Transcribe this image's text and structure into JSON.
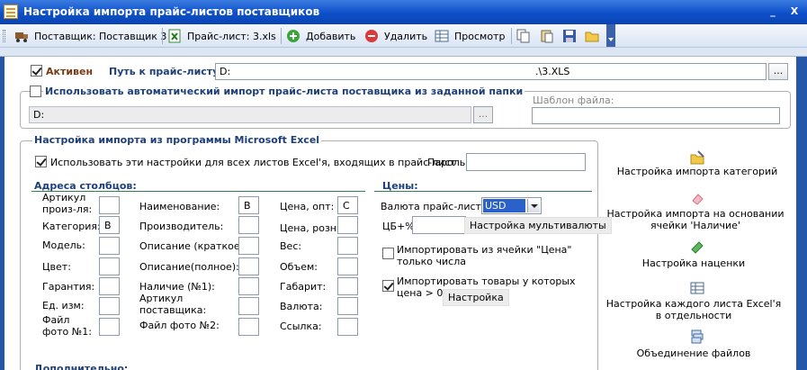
{
  "window": {
    "title": "Настройка импорта прайс-листов поставщиков",
    "minimize": "_",
    "close": "X"
  },
  "toolbar": {
    "supplier_label": "Поставщик: Поставщик 3",
    "pricelist_label": "Прайс-лист: 3.xls",
    "add_label": "Добавить",
    "delete_label": "Удалить",
    "view_label": "Просмотр"
  },
  "top": {
    "active_label": "Активен",
    "path_label": "Путь к прайс-листу:",
    "path_prefix": "D:",
    "path_suffix": ".\\3.XLS",
    "browse": "...",
    "auto_import_label": "Использовать автоматический импорт прайс-листа поставщика из заданной папки",
    "folder_value": "D:",
    "template_label": "Шаблон файла:"
  },
  "excel": {
    "title": "Настройка импорта из программы Microsoft Excel",
    "use_all_sheets_label": "Использовать эти настройки для всех листов Excel'я, входящих в прайс-лист",
    "password_label": "Пароль:"
  },
  "columns": {
    "title": "Адреса столбцов:",
    "col1": [
      {
        "label": "Артикул произ-ля:",
        "value": ""
      },
      {
        "label": "Категория:",
        "value": "B"
      },
      {
        "label": "Модель:",
        "value": ""
      },
      {
        "label": "Цвет:",
        "value": ""
      },
      {
        "label": "Гарантия:",
        "value": ""
      },
      {
        "label": "Ед. изм:",
        "value": ""
      },
      {
        "label": "Файл фото №1:",
        "value": ""
      }
    ],
    "col2": [
      {
        "label": "Наименование:",
        "value": "B"
      },
      {
        "label": "Производитель:",
        "value": ""
      },
      {
        "label": "Описание (краткое):",
        "value": ""
      },
      {
        "label": "Описание(полное):",
        "value": ""
      },
      {
        "label": "Наличие (№1):",
        "value": ""
      },
      {
        "label": "Артикул поставщика:",
        "value": ""
      },
      {
        "label": "Файл фото №2:",
        "value": ""
      }
    ],
    "col3": [
      {
        "label": "Цена, опт:",
        "value": "C"
      },
      {
        "label": "Цена, розн:",
        "value": ""
      },
      {
        "label": "Вес:",
        "value": ""
      },
      {
        "label": "Объем:",
        "value": ""
      },
      {
        "label": "Габарит:",
        "value": ""
      },
      {
        "label": "Валюта:",
        "value": ""
      },
      {
        "label": "Ссылка:",
        "value": ""
      }
    ]
  },
  "prices": {
    "title": "Цены:",
    "currency_label": "Валюта прайс-листа:",
    "currency_value": "USD",
    "cb_label": "ЦБ+%",
    "multicurrency_button": "Настройка мультивалюты",
    "import_from_price_cell": "Импортировать из ячейки \"Цена\" только числа",
    "import_positive_price": "Импортировать товары у которых цена > 0",
    "settings_button": "Настройка"
  },
  "extra": {
    "title": "Дополнительно:"
  },
  "right_links": [
    {
      "label": "Настройка импорта категорий",
      "icon": "folder-edit-icon"
    },
    {
      "label": "Настройка импорта на основании ячейки 'Наличие'",
      "icon": "eraser-icon"
    },
    {
      "label": "Настройка наценки",
      "icon": "money-icon"
    },
    {
      "label": "Настройка каждого листа Excel'я в отдельности",
      "icon": "sheet-icon"
    },
    {
      "label": "Объединение файлов",
      "icon": "merge-files-icon"
    }
  ],
  "colors": {
    "title_bar": "#0d4fc9",
    "section_title": "#1e3f7a",
    "section_line": "#2c7f5a",
    "side_strip": "#2456a9"
  }
}
